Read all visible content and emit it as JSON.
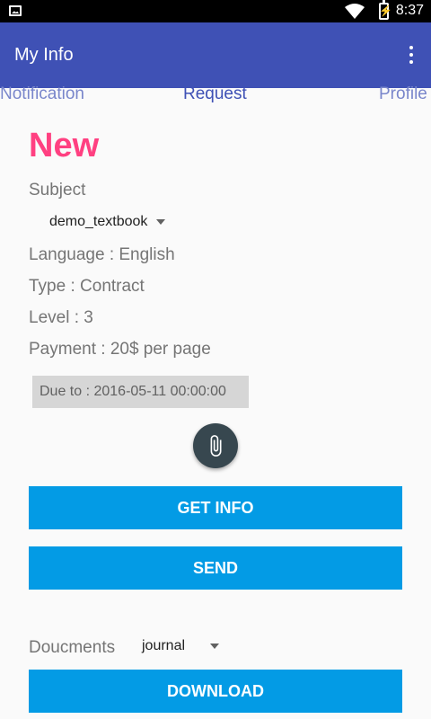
{
  "status_bar": {
    "time": "8:37"
  },
  "app_bar": {
    "title": "My Info"
  },
  "tabs": [
    {
      "label": "Notification"
    },
    {
      "label": "Request"
    },
    {
      "label": "Profile"
    }
  ],
  "request": {
    "heading": "New",
    "subject_label": "Subject",
    "subject_value": "demo_textbook",
    "language": "Language : English",
    "type": "Type : Contract",
    "level": "Level : 3",
    "payment": "Payment : 20$ per page",
    "due": "Due to : 2016-05-11 00:00:00"
  },
  "buttons": {
    "get_info": "GET INFO",
    "send": "SEND",
    "download": "DOWNLOAD"
  },
  "documents": {
    "label": "Doucments",
    "selected": "journal"
  },
  "icons": {
    "attachment": "paperclip-icon",
    "menu": "more-vert-icon"
  },
  "colors": {
    "app_bar": "#3f51b5",
    "accent": "#ff4081",
    "button": "#039be5"
  }
}
